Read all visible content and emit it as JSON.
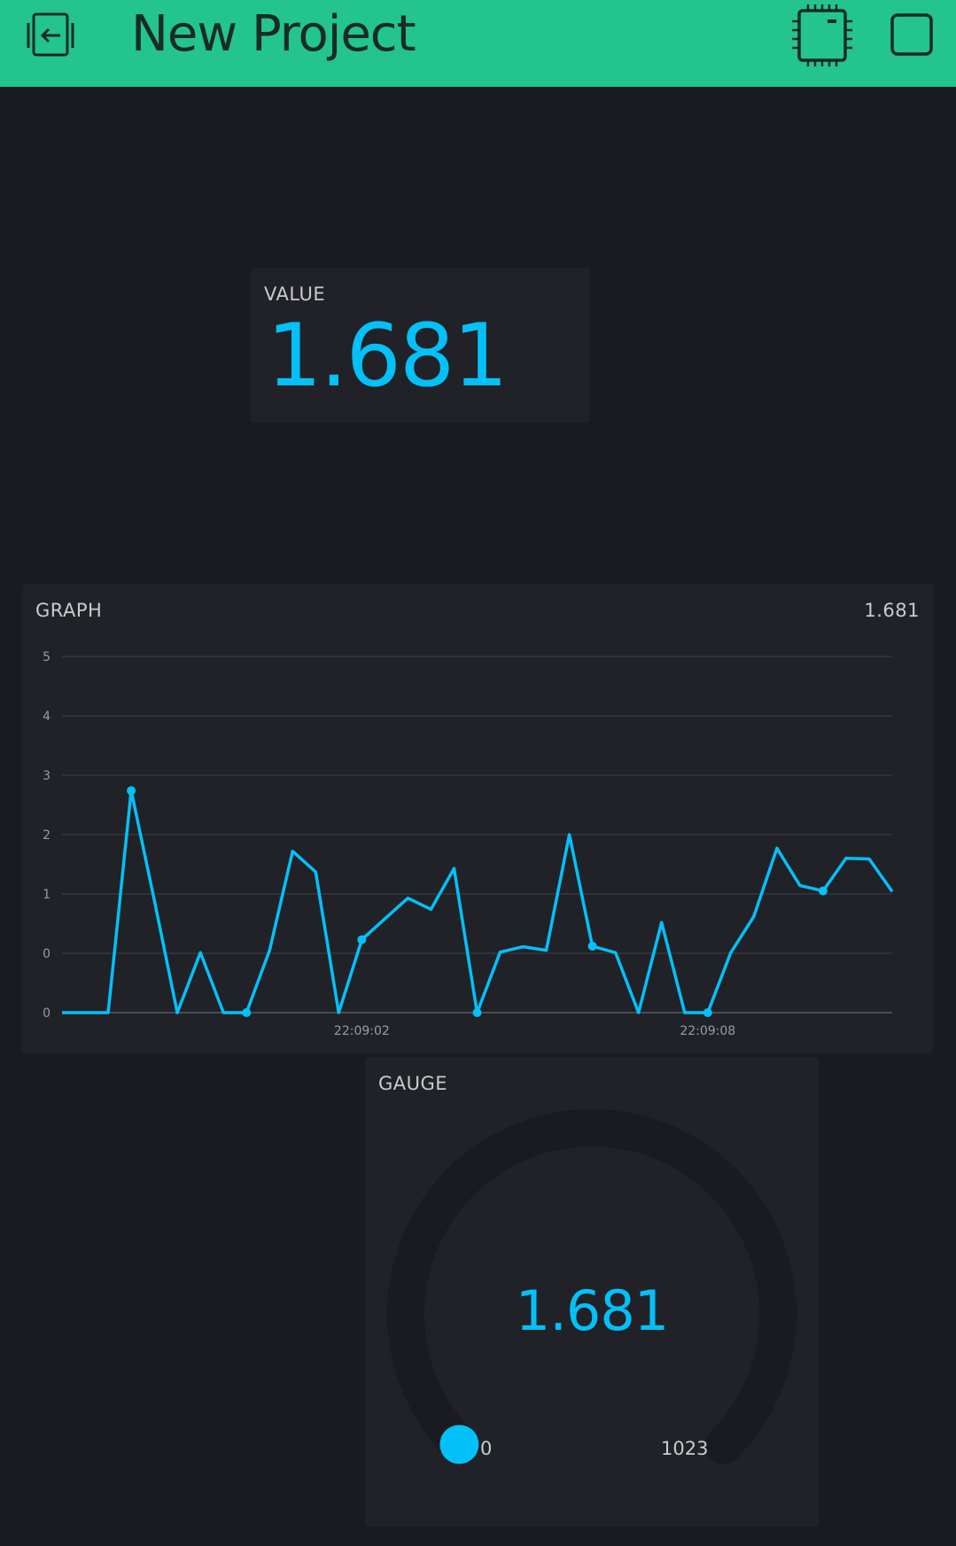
{
  "header": {
    "title": "New Project",
    "colors": {
      "bar": "#23c48e",
      "icon": "#1b2b24"
    },
    "icons": {
      "back": "exit-icon",
      "device": "chip-icon",
      "stop": "stop-icon"
    }
  },
  "value_widget": {
    "label": "VALUE",
    "value": "1.681",
    "color": "#04c0f8"
  },
  "graph_widget": {
    "label": "GRAPH",
    "current_value": "1.681",
    "line_color": "#04c0f8"
  },
  "gauge_widget": {
    "label": "GAUGE",
    "value": "1.681",
    "min": "0",
    "max": "1023",
    "fraction": 0.0016
  },
  "chart_data": {
    "type": "line",
    "title": "",
    "xlabel": "",
    "ylabel": "",
    "ylim": [
      0,
      5
    ],
    "yticks": [
      "0",
      "0",
      "1",
      "2",
      "3",
      "4",
      "5"
    ],
    "xtick_labels": [
      {
        "label": "22:09:02",
        "index": 13
      },
      {
        "label": "22:09:08",
        "index": 28
      }
    ],
    "grid": true,
    "series": [
      {
        "values": [
          0,
          0,
          0,
          2.74,
          0.9,
          0,
          0.01,
          0,
          0,
          0.05,
          1.72,
          1.37,
          0,
          0.23,
          0.58,
          0.93,
          0.74,
          1.43,
          0,
          0.02,
          0.11,
          0.05,
          2.0,
          0.12,
          0.01,
          0,
          0.52,
          0,
          0,
          0.01,
          0.62,
          1.77,
          1.14,
          1.05,
          1.6,
          1.59,
          1.04
        ],
        "markers": [
          3,
          8,
          13,
          18,
          23,
          28,
          33
        ]
      }
    ]
  }
}
